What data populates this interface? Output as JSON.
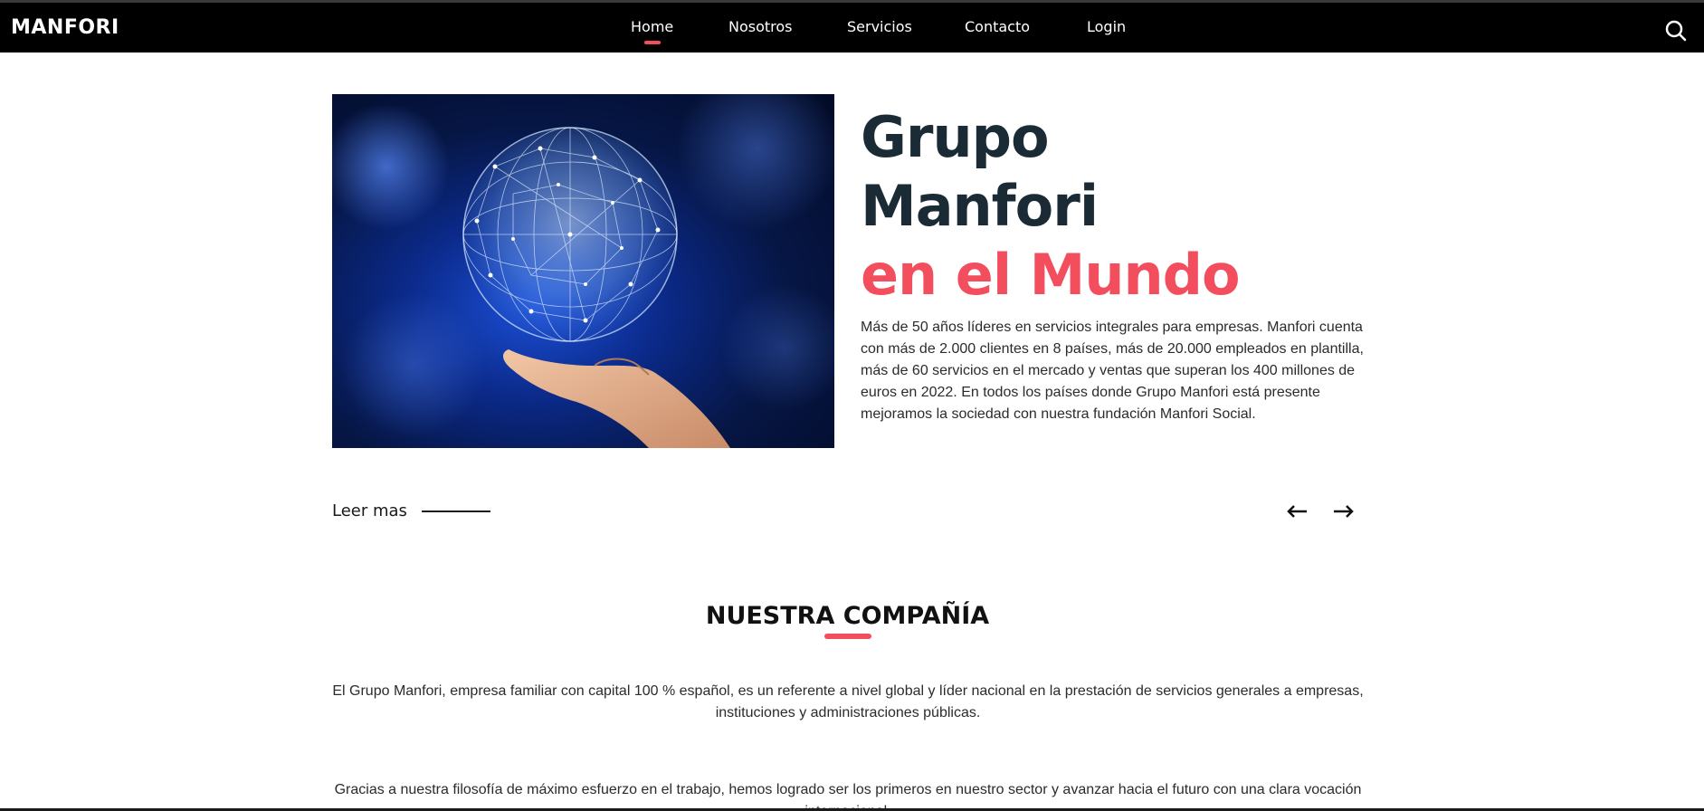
{
  "navbar": {
    "logo": "MANFORI",
    "links": [
      {
        "label": "Home",
        "active": true
      },
      {
        "label": "Nosotros",
        "active": false
      },
      {
        "label": "Servicios",
        "active": false
      },
      {
        "label": "Contacto",
        "active": false
      },
      {
        "label": "Login",
        "active": false
      }
    ],
    "search_icon": "search-icon"
  },
  "hero": {
    "image": "globe-network-hand-image",
    "title_line1": "Grupo",
    "title_line2": "Manfori",
    "title_line3": "en el Mundo",
    "description": "Más de 50 años líderes en servicios integrales para empresas. Manfori cuenta con más de 2.000 clientes en 8 países, más de 20.000 empleados en plantilla, más de 60 servicios en el mercado y ventas que superan los 400 millones de euros en 2022. En todos los países donde Grupo Manfori está presente mejoramos la sociedad con nuestra fundación Manfori Social.",
    "read_more": "Leer mas",
    "prev_icon": "arrow-left-icon",
    "next_icon": "arrow-right-icon"
  },
  "company": {
    "title": "NUESTRA COMPAÑÍA",
    "paragraph1": "El Grupo Manfori, empresa familiar con capital 100 % español, es un referente a nivel global y líder nacional en la prestación de servicios generales a empresas, instituciones y administraciones públicas.",
    "paragraph2": "Gracias a nuestra filosofía de máximo esfuerzo en el trabajo, hemos logrado ser los primeros en nuestro sector y avanzar hacia el futuro con una clara vocación internacional."
  },
  "colors": {
    "accent": "#f24e5e",
    "title_dark": "#1b2b35",
    "navbar_bg": "#000000"
  }
}
